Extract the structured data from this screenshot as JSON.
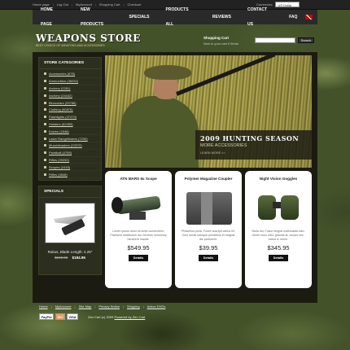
{
  "top_links": [
    "Home page",
    "Log Out",
    "MyAccount",
    "Shopping Cart",
    "Checkout"
  ],
  "currency": {
    "label": "Currencies:",
    "value": "US Dollar"
  },
  "nav": [
    "Home page",
    "New products",
    "Specials",
    "Products all",
    "Reviews",
    "Contact us",
    "FAQ"
  ],
  "header": {
    "logo": "WEAPONS STORE",
    "tagline": "Best choice of weapons and accessories",
    "cart_title": "Shopping Cart",
    "cart_text": "Now in your cart 0 items",
    "search_button": "Search"
  },
  "categories": {
    "title": "Store Categories",
    "items": [
      "Accessories (678)",
      "Ammunition (38292)",
      "Archery (2281)",
      "Archery (24442)",
      "Binoculars (25786)",
      "Clothing (50876)",
      "Flashlights (47470)",
      "Holsters (62459)",
      "Knives (1848)",
      "Laser Rangefinders (7230)",
      "Muzzleloaders (22570)",
      "Paintball (4789)",
      "Rifles (29292)",
      "Scopes (2418)",
      "Rifles (4848)"
    ]
  },
  "specials": {
    "title": "Specials",
    "name": "Rukus, Blade Length: 4.25\"",
    "old_price": "$248.95",
    "new_price": "$184.95"
  },
  "banner": {
    "title": "2009 HUNTING SEASON",
    "subtitle": "MORE ACCESSORIES",
    "more": "LEARN MORE >>"
  },
  "products": [
    {
      "name": "ATN MARS 6x Scope",
      "desc": "Lorem ipsum dolor sit amet consectetur. Praesent vestibulum dui. Aenean nonummy hendrerit mauris.",
      "price": "$549.95",
      "button": "Details",
      "image": "scope-image"
    },
    {
      "name": "Polymer Magazine Coupler",
      "desc": "Phasellus porta. Fusce suscipit varius mi. Cum sociis natoque penatibus et magnis dis parturient.",
      "price": "$39.95",
      "button": "Details",
      "image": "magazine-image"
    },
    {
      "name": "Night Vision Goggles",
      "desc": "Nulla dui. Fusce feugiat malesuada odio. Morbi nunc odio, gravida at, cursus nec, luctus a, lorem.",
      "price": "$345.95",
      "button": "Details",
      "image": "binoculars-image"
    }
  ],
  "footer": {
    "links": [
      "Home",
      "MyAccount",
      "Site Map",
      "Privacy Notice",
      "Shipping",
      "Action DVDs"
    ],
    "pay_paypal": "PayPal",
    "pay_mc": "MC",
    "pay_visa": "VISA",
    "copyright": "Zen Cart (c) 2009",
    "powered": "Powered by Zen Cart"
  }
}
